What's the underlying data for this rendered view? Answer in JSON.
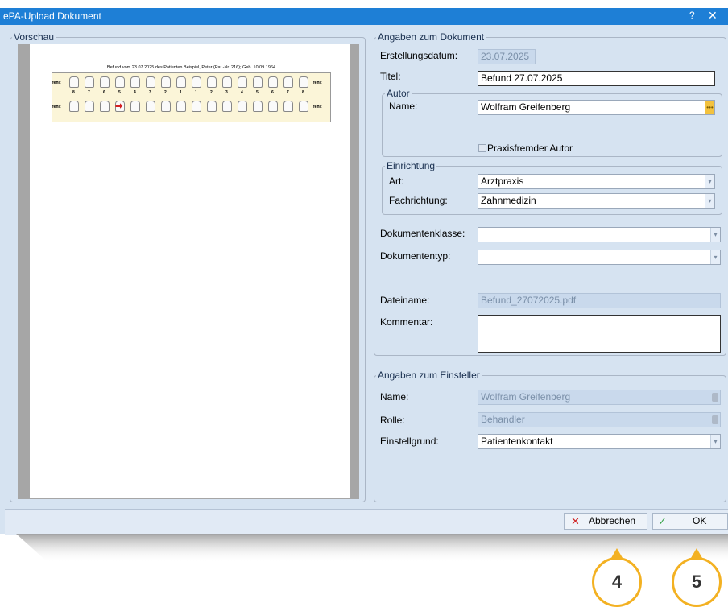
{
  "window": {
    "title": "ePA-Upload Dokument",
    "help": "?",
    "close": "✕"
  },
  "preview": {
    "legend": "Vorschau",
    "chart_header": "Befund vom 23.07.2025 des Patienten Beispiel, Peter (Pat.-Nr.  216); Geb. 10.09.1964",
    "fehlt": "fehlt",
    "upper_numbers": [
      "8",
      "7",
      "6",
      "5",
      "4",
      "3",
      "2",
      "1",
      "1",
      "2",
      "3",
      "4",
      "5",
      "6",
      "7",
      "8"
    ]
  },
  "dokument": {
    "legend": "Angaben zum Dokument",
    "erstellungsdatum_label": "Erstellungsdatum:",
    "erstellungsdatum_value": "23.07.2025",
    "titel_label": "Titel:",
    "titel_value": "Befund 27.07.2025",
    "autor_legend": "Autor",
    "autor_name_label": "Name:",
    "autor_name_value": "Wolfram Greifenberg",
    "praxisfremder_label": "Praxisfremder Autor",
    "einrichtung_legend": "Einrichtung",
    "art_label": "Art:",
    "art_value": "Arztpraxis",
    "fachrichtung_label": "Fachrichtung:",
    "fachrichtung_value": "Zahnmedizin",
    "dokumentenklasse_label": "Dokumentenklasse:",
    "dokumentenklasse_value": "",
    "dokumententyp_label": "Dokumententyp:",
    "dokumententyp_value": "",
    "dateiname_label": "Dateiname:",
    "dateiname_value": "Befund_27072025.pdf",
    "kommentar_label": "Kommentar:",
    "kommentar_value": ""
  },
  "einsteller": {
    "legend": "Angaben zum Einsteller",
    "name_label": "Name:",
    "name_value": "Wolfram Greifenberg",
    "rolle_label": "Rolle:",
    "rolle_value": "Behandler",
    "grund_label": "Einstellgrund:",
    "grund_value": "Patientenkontakt"
  },
  "buttons": {
    "cancel_label": "Abbrechen",
    "ok_label": "OK"
  },
  "callouts": [
    "4",
    "5"
  ],
  "colors": {
    "titlebar": "#1e7fd6",
    "dialog_bg": "#d6e3f1",
    "callout_ring": "#f3b122",
    "dropdown_gold": "#f3c23e"
  }
}
